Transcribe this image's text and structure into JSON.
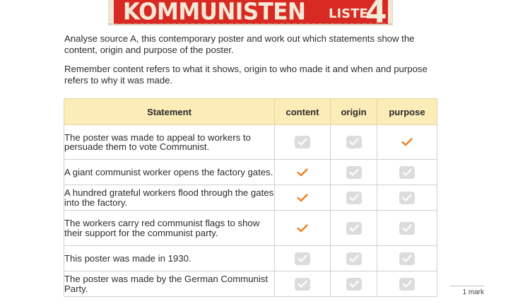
{
  "poster": {
    "title": "KOMMUNISTEN",
    "liste": "LISTE",
    "number": "4",
    "colors": {
      "red": "#d82a22",
      "paper": "#f2e9d8"
    }
  },
  "instructions": {
    "line1": "Analyse source A, this contemporary poster and work out which statements show the content, origin and purpose of the poster.",
    "line2": "Remember content refers to what it shows, origin to who made it and when and purpose refers to why it was made."
  },
  "table": {
    "headers": [
      "Statement",
      "content",
      "origin",
      "purpose"
    ],
    "rows": [
      {
        "statement": "The poster was made to appeal to workers to persuade them to vote Communist.",
        "content": false,
        "origin": false,
        "purpose": true
      },
      {
        "statement": "A giant communist worker opens the factory gates.",
        "content": true,
        "origin": false,
        "purpose": false
      },
      {
        "statement": "A hundred grateful workers flood through the gates into the factory.",
        "content": true,
        "origin": false,
        "purpose": false
      },
      {
        "statement": "The workers carry red communist flags to show their support for the communist party.",
        "content": true,
        "origin": false,
        "purpose": false
      },
      {
        "statement": "This poster was made in 1930.",
        "content": false,
        "origin": false,
        "purpose": false
      },
      {
        "statement": "The poster was made by the German Communist Party.",
        "content": false,
        "origin": false,
        "purpose": false
      }
    ],
    "colors": {
      "header_bg": "#fcedb8",
      "tick": "#ef7d1f",
      "unchecked": "#dcdcdc"
    }
  },
  "mark_label": "1 mark"
}
